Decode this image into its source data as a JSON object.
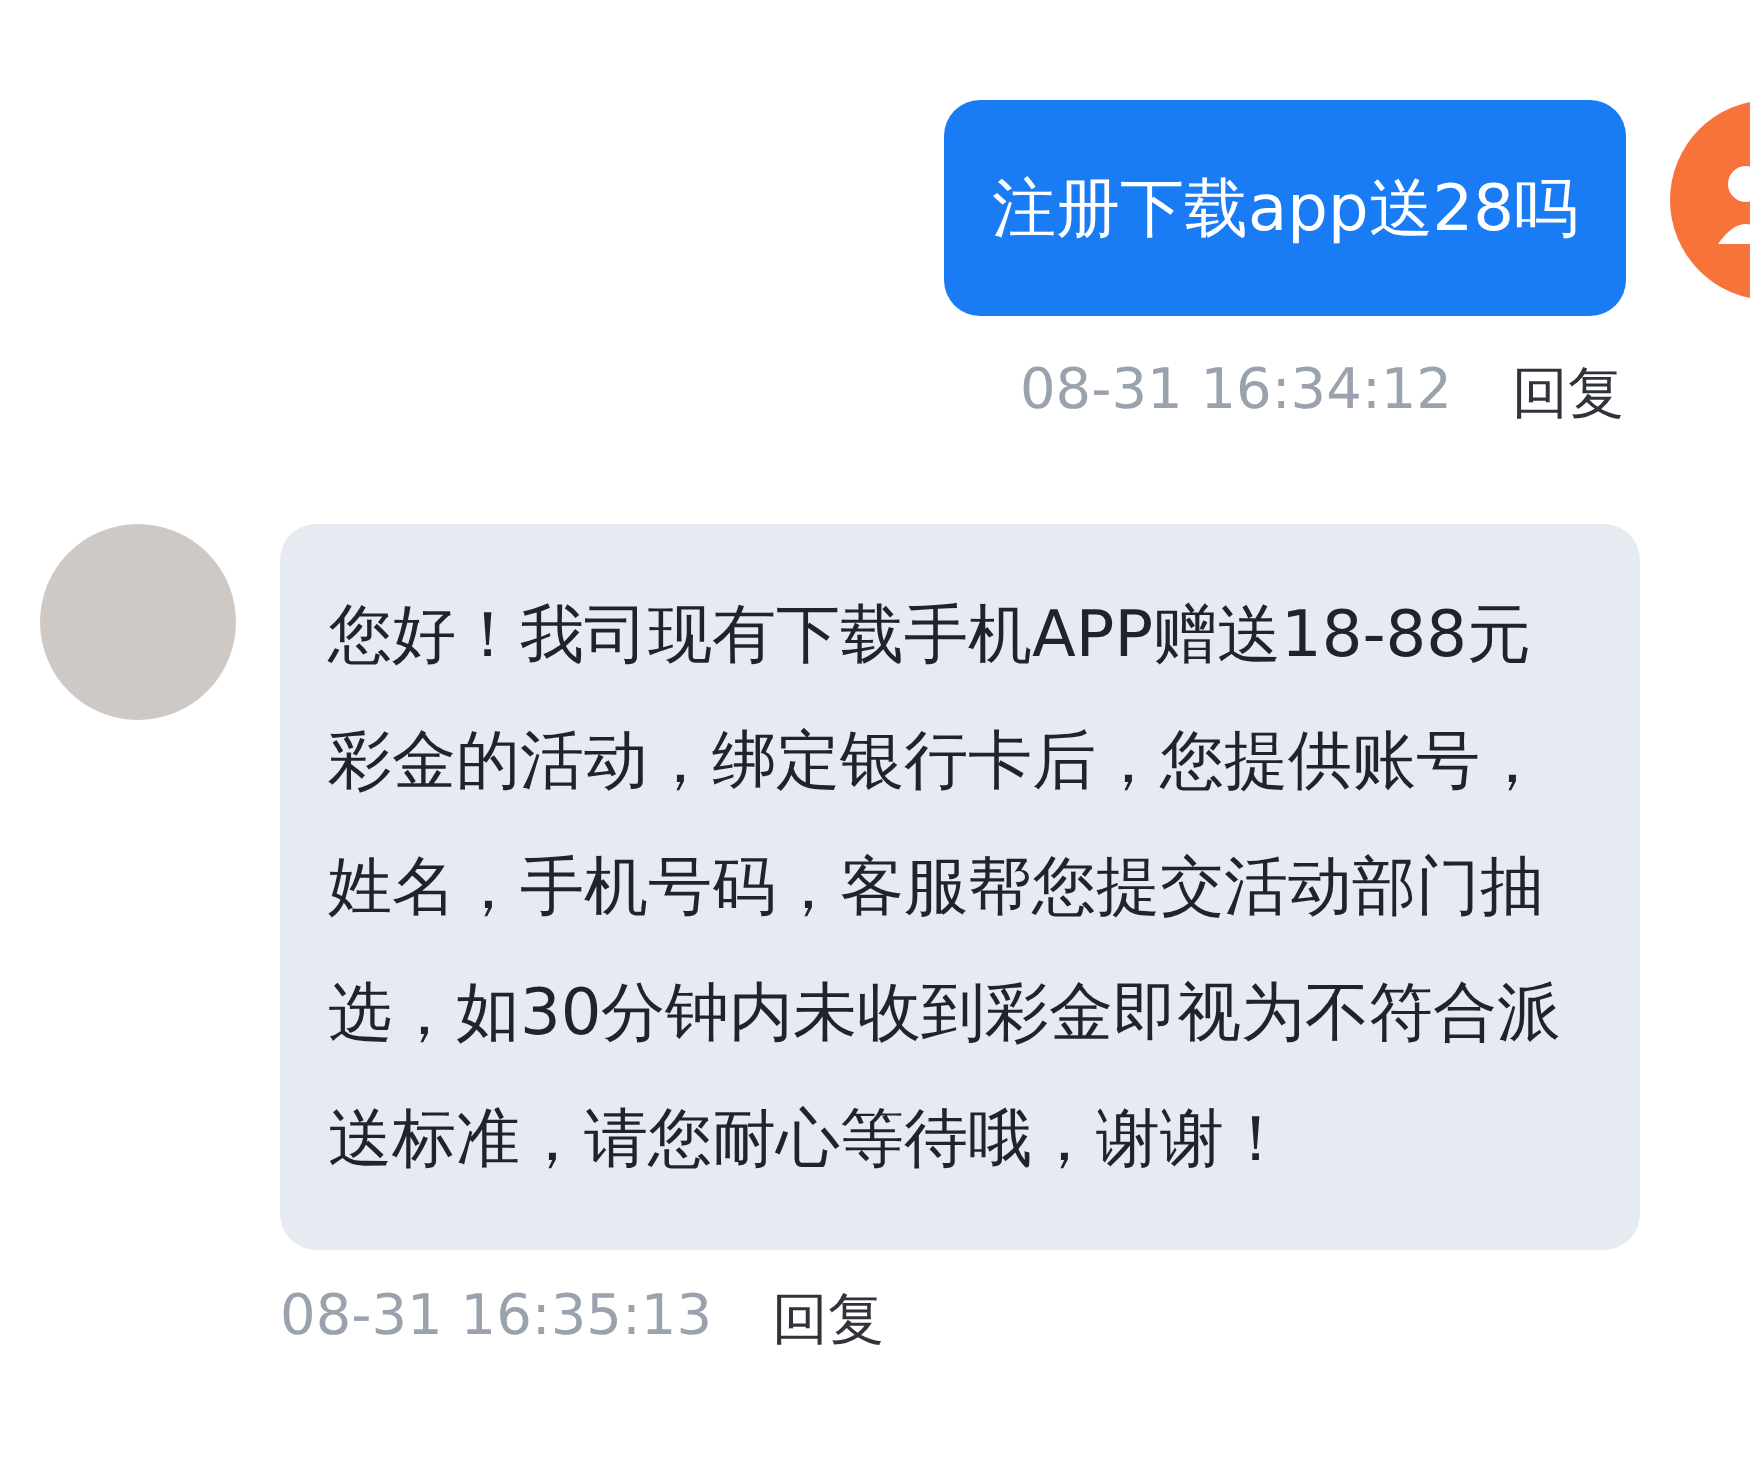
{
  "messages": [
    {
      "kind": "sent",
      "text": "注册下载app送28吗",
      "time": "08-31 16:34:12",
      "action": "回复"
    },
    {
      "kind": "received",
      "text": "您好！我司现有下载手机APP赠送18-88元彩金的活动，绑定银行卡后，您提供账号，姓名，手机号码，客服帮您提交活动部门抽选，如30分钟内未收到彩金即视为不符合派送标准，请您耐心等待哦，谢谢！",
      "time": "08-31 16:35:13",
      "action": "回复"
    }
  ]
}
